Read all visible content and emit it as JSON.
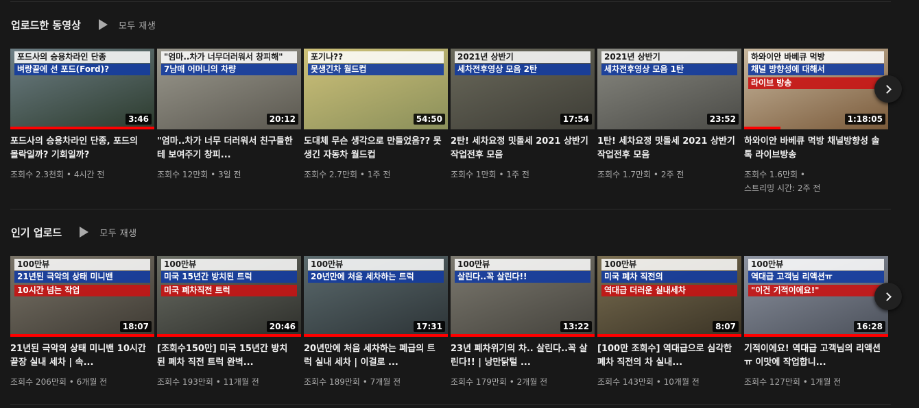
{
  "shelves": [
    {
      "title": "업로드한 동영상",
      "play_all": "모두 재생",
      "videos": [
        {
          "title": "포드사의 승용차라인 단종, 포드의 몰락일까? 기회일까?",
          "views": "조회수 2.3천회",
          "age": "4시간 전",
          "duration": "3:46",
          "thumb_texts": [
            "포드사의 승용차라인 단종",
            "벼랑끝에 선 포드(Ford)?"
          ],
          "progress": 1.0,
          "colors": [
            "#6e7f86",
            "#2b3a2c"
          ]
        },
        {
          "title": "\"엄마..차가 너무 더러워서 친구들한테 보여주기 창피...",
          "views": "조회수 12만회",
          "age": "3일 전",
          "duration": "20:12",
          "thumb_texts": [
            "\"엄마..차가 너무더러워서 창피해\"",
            "7남매 어머니의 차량"
          ],
          "progress": 0,
          "colors": [
            "#9c9a8f",
            "#5a574f"
          ]
        },
        {
          "title": "도대체 무슨 생각으로 만들었음?? 못생긴 자동차 월드컵",
          "views": "조회수 2.7만회",
          "age": "1주 전",
          "duration": "54:50",
          "thumb_texts": [
            "포기나??",
            "못생긴차 월드컵"
          ],
          "progress": 0,
          "colors": [
            "#cfc27a",
            "#8a8f5a"
          ]
        },
        {
          "title": "2탄! 세차요정 밋돌세 2021 상반기 작업전후 모음",
          "views": "조회수 1만회",
          "age": "1주 전",
          "duration": "17:54",
          "thumb_texts": [
            "2021년 상반기",
            "세차전후영상 모음 2탄"
          ],
          "progress": 0,
          "colors": [
            "#6b6a5c",
            "#3d3c35"
          ]
        },
        {
          "title": "1탄! 세차요정 밋돌세 2021 상반기 작업전후 모음",
          "views": "조회수 1.7만회",
          "age": "2주 전",
          "duration": "23:52",
          "thumb_texts": [
            "2021년 상반기",
            "세차전후영상 모음 1탄"
          ],
          "progress": 0,
          "colors": [
            "#8a8a82",
            "#4a4a46"
          ]
        },
        {
          "title": "하와이안 바베큐 먹방 채널방향성 솔톡 라이브방송",
          "views": "조회수 1.6만회",
          "age": "스트리밍 시간: 2주 전",
          "duration": "1:18:05",
          "thumb_texts": [
            "하와이안 바베큐 먹방",
            "채널 방향성에 대해서",
            "라이브 방송"
          ],
          "progress": 0.25,
          "colors": [
            "#c9b9a0",
            "#7a5a3a"
          ]
        }
      ]
    },
    {
      "title": "인기 업로드",
      "play_all": "모두 재생",
      "videos": [
        {
          "title": "21년된 극악의 상태 미니밴 10시간 끝장 실내 세차 | 속...",
          "views": "조회수 206만회",
          "age": "6개월 전",
          "duration": "18:07",
          "thumb_texts": [
            "100만뷰",
            "21년된 극악의 상태 미니밴",
            "10시간 넘는 작업"
          ],
          "progress": 1.0,
          "colors": [
            "#7a7468",
            "#3e3a33"
          ]
        },
        {
          "title": "[조회수150만] 미국 15년간 방치된 폐차 직전 트럭 완벽...",
          "views": "조회수 193만회",
          "age": "11개월 전",
          "duration": "20:46",
          "thumb_texts": [
            "100만뷰",
            "미국 15년간 방치된 트럭",
            "미국 폐차직전 트럭"
          ],
          "progress": 1.0,
          "colors": [
            "#6a6d64",
            "#2e2f2b"
          ]
        },
        {
          "title": "20년만에 처음 세차하는 폐급의 트럭 실내 세차 | 이걸로 ...",
          "views": "조회수 189만회",
          "age": "7개월 전",
          "duration": "17:31",
          "thumb_texts": [
            "100만뷰",
            "20년만에 처음 세차하는 트럭"
          ],
          "progress": 1.0,
          "colors": [
            "#5c6b6e",
            "#2c3336"
          ]
        },
        {
          "title": "23년 폐차위기의 차.. 살린다..꼭 살린다!! | 낭만닭털 ...",
          "views": "조회수 179만회",
          "age": "2개월 전",
          "duration": "13:22",
          "thumb_texts": [
            "100만뷰",
            "살린다..꼭 살린다!!"
          ],
          "progress": 1.0,
          "colors": [
            "#7d7a70",
            "#44423c"
          ]
        },
        {
          "title": "[100만 조회수] 역대급으로 심각한 폐차 직전의 차 실내...",
          "views": "조회수 143만회",
          "age": "10개월 전",
          "duration": "8:07",
          "thumb_texts": [
            "100만뷰",
            "미국 폐차 직전의",
            "역대급 더러운 실내세차"
          ],
          "progress": 1.0,
          "colors": [
            "#7b6f52",
            "#3a3325"
          ]
        },
        {
          "title": "기적이에요! 역대급 고객님의 리액션ㅠ 이맛에 작업합니...",
          "views": "조회수 127만회",
          "age": "1개월 전",
          "duration": "16:28",
          "thumb_texts": [
            "100만뷰",
            "역대급 고객님 리액션ㅠ",
            "\"이건 기적이에요!\""
          ],
          "progress": 1.0,
          "colors": [
            "#8d93a0",
            "#4b505a"
          ]
        }
      ]
    }
  ]
}
